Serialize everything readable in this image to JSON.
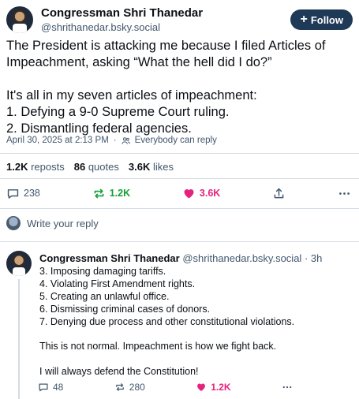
{
  "post": {
    "author_name": "Congressman Shri Thanedar",
    "author_handle": "@shrithanedar.bsky.social",
    "follow_label": "Follow",
    "text": "The President is attacking me because I filed Articles of Impeachment, asking  “What the hell did I do?”\n\nIt's all in my seven articles of impeachment:\n1. Defying a 9-0 Supreme Court ruling.\n2. Dismantling federal agencies.",
    "timestamp": "April 30, 2025 at 2:13 PM",
    "reply_setting": "Everybody can reply"
  },
  "stats": {
    "reposts_count": "1.2K",
    "reposts_label": "reposts",
    "quotes_count": "86",
    "quotes_label": "quotes",
    "likes_count": "3.6K",
    "likes_label": "likes"
  },
  "actions": {
    "reply_count": "238",
    "repost_count": "1.2K",
    "like_count": "3.6K"
  },
  "composer": {
    "placeholder": "Write your reply"
  },
  "reply": {
    "author_name": "Congressman Shri Thanedar",
    "author_handle": "@shrithanedar.bsky.social",
    "age": "· 3h",
    "text": "3. Imposing damaging tariffs.\n4. Violating First Amendment rights.\n5. Creating an unlawful office.\n6. Dismissing criminal cases of donors.\n7. Denying due process and other constitutional violations.\n\nThis is not normal. Impeachment is how we fight back.\n\nI will always defend the Constitution!",
    "reply_count": "48",
    "repost_count": "280",
    "like_count": "1.2K"
  },
  "colors": {
    "accent": "#1f3a57",
    "repost_active": "#13a037",
    "like_active": "#e5227d",
    "muted": "#42576c"
  },
  "icons": [
    "plus-icon",
    "people-icon",
    "reply-icon",
    "repost-icon",
    "heart-icon",
    "share-icon",
    "more-icon"
  ]
}
